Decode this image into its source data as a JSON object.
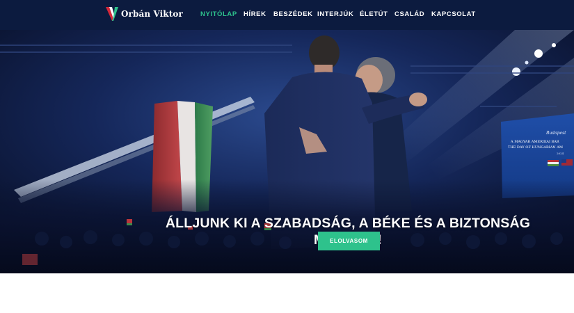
{
  "brand": {
    "name": "Orbán Viktor",
    "logo_icon": "v-logo-icon",
    "colors": {
      "red": "#d6283a",
      "green": "#2ec28c",
      "navy": "#0c1b3f",
      "white": "#ffffff"
    }
  },
  "nav": {
    "items": [
      {
        "label": "NYITÓLAP",
        "active": true
      },
      {
        "label": "HÍREK",
        "active": false
      },
      {
        "label": "BESZÉDEK",
        "active": false
      },
      {
        "label": "INTERJÚK",
        "active": false
      },
      {
        "label": "ÉLETÚT",
        "active": false
      },
      {
        "label": "CSALÁD",
        "active": false
      },
      {
        "label": "KAPCSOLAT",
        "active": false
      }
    ]
  },
  "hero": {
    "headline_line1": "ÁLLJUNK KI A SZABADSÁG, A BÉKE ÉS A BIZTONSÁG",
    "headline_line2": "MELLETT!",
    "cta_label": "ELOLVASOM",
    "screen_text": {
      "line1": "Budapest",
      "line2": "A MAGYAR AMERIKAI BAR",
      "line3": "THE DAY OF HUNGARIAN AM",
      "line4": "2024"
    }
  }
}
